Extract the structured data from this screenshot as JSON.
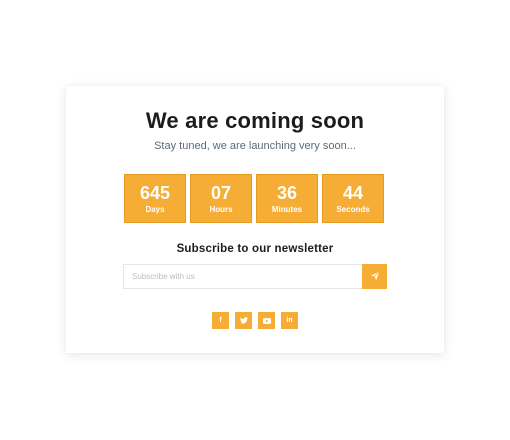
{
  "hero": {
    "title": "We are coming soon",
    "subtitle": "Stay tuned, we are launching very soon..."
  },
  "countdown": [
    {
      "value": "645",
      "label": "Days"
    },
    {
      "value": "07",
      "label": "Hours"
    },
    {
      "value": "36",
      "label": "Minutes"
    },
    {
      "value": "44",
      "label": "Seconds"
    }
  ],
  "newsletter": {
    "heading": "Subscribe to our newsletter",
    "input_value": "",
    "placeholder": "Subscribe with us",
    "submit_icon": "paper-plane-icon"
  },
  "social": [
    {
      "name": "facebook",
      "icon": "facebook-icon",
      "glyph": "f"
    },
    {
      "name": "twitter",
      "icon": "twitter-icon",
      "glyph": ""
    },
    {
      "name": "youtube",
      "icon": "youtube-icon",
      "glyph": ""
    },
    {
      "name": "linkedin",
      "icon": "linkedin-icon",
      "glyph": "in"
    }
  ],
  "colors": {
    "accent": "#f6ad35",
    "accent_border": "#e59a1e",
    "title": "#1c1c1c",
    "subtitle": "#5b6b7a",
    "card_bg": "#ffffff"
  }
}
